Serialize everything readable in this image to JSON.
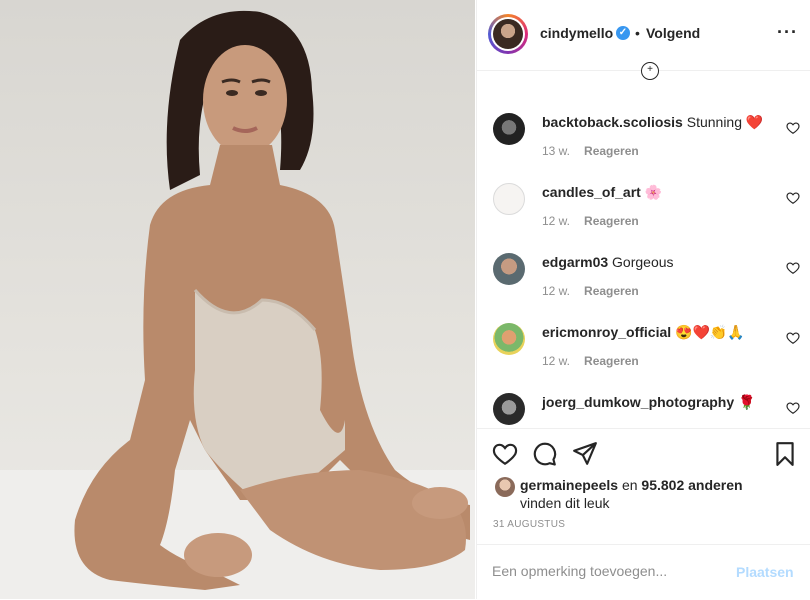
{
  "post": {
    "author": {
      "username": "cindymello",
      "verified": true,
      "follow_label": "Volgend",
      "separator": "•"
    },
    "more_icon": "more-dots-icon",
    "comments": [
      {
        "username": "backtoback.scoliosis",
        "text": "Stunning ❤️",
        "age": "13 w.",
        "reply_label": "Reageren"
      },
      {
        "username": "candles_of_art",
        "text": "🌸",
        "age": "12 w.",
        "reply_label": "Reageren"
      },
      {
        "username": "edgarm03",
        "text": "Gorgeous",
        "age": "12 w.",
        "reply_label": "Reageren"
      },
      {
        "username": "ericmonroy_official",
        "text": "😍❤️👏🙏",
        "age": "12 w.",
        "reply_label": "Reageren"
      },
      {
        "username": "joerg_dumkow_photography",
        "text": "🌹",
        "age": "",
        "reply_label": ""
      }
    ],
    "likes": {
      "first_user": "germainepeels",
      "connector": "en",
      "count": "95.802 anderen",
      "suffix": "vinden dit leuk"
    },
    "date": "31 AUGUSTUS",
    "add_comment": {
      "placeholder": "Een opmerking toevoegen...",
      "post_label": "Plaatsen"
    },
    "colors": {
      "accent": "#3897f0",
      "post_disabled": "#b3dbff",
      "muted": "#8e8e8e",
      "heart_red": "#ed4956"
    }
  }
}
